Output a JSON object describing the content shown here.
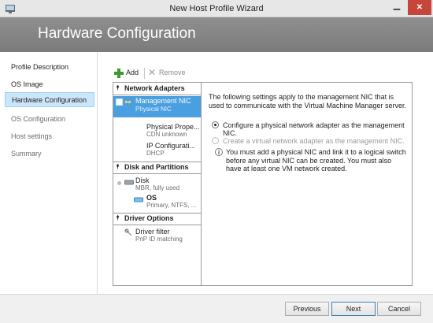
{
  "window": {
    "title": "New Host Profile Wizard",
    "close_glyph": "✕",
    "minimize_glyph": "▁"
  },
  "banner": {
    "title": "Hardware Configuration"
  },
  "nav": {
    "items": [
      {
        "label": "Profile Description"
      },
      {
        "label": "OS Image"
      },
      {
        "label": "Hardware Configuration"
      },
      {
        "label": "OS Configuration"
      },
      {
        "label": "Host settings"
      },
      {
        "label": "Summary"
      }
    ]
  },
  "toolbar": {
    "add_label": "Add",
    "remove_label": "Remove"
  },
  "tree": {
    "groups": {
      "network": "Network Adapters",
      "disk": "Disk and Partitions",
      "driver": "Driver Options"
    },
    "nodes": {
      "mgmt_nic": {
        "title": "Management NIC",
        "sub": "Physical NIC"
      },
      "phys_props": {
        "title": "Physical Prope...",
        "sub": "CDN unknown"
      },
      "ip_config": {
        "title": "IP Configurati...",
        "sub": "DHCP"
      },
      "disk": {
        "title": "Disk",
        "sub": "MBR, fully used"
      },
      "os": {
        "title": "OS",
        "sub": "Primary, NTFS, ..."
      },
      "driver_filter": {
        "title": "Driver filter",
        "sub": "PnP ID matching"
      }
    }
  },
  "panel": {
    "intro": "The following settings apply to the management NIC that is used to communicate with the Virtual Machine Manager server.",
    "option_physical": "Configure a physical network adapter as the management NIC.",
    "option_virtual": "Create a virtual network adapter as the management NIC.",
    "info": "You must add a physical NIC and link it to a logical switch before any virtual NIC can be created. You must also have at least one VM network created."
  },
  "footer": {
    "previous": "Previous",
    "next": "Next",
    "cancel": "Cancel"
  },
  "colors": {
    "selection": "#4a9fe0",
    "banner": "#858585",
    "nav_selected": "#cbe6f8"
  }
}
